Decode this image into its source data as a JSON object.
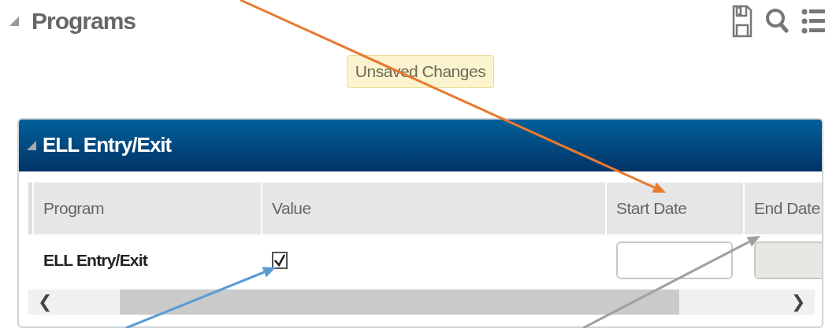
{
  "page": {
    "title": "Programs",
    "expanded": true
  },
  "toolbar": [
    {
      "kind": "save"
    },
    {
      "kind": "search"
    },
    {
      "kind": "list"
    }
  ],
  "status_badge": "Unsaved Changes",
  "panel": {
    "title": "ELL Entry/Exit",
    "expanded": true,
    "table": {
      "columns": [
        "Program",
        "Value",
        "Start Date",
        "End Date"
      ],
      "rows": [
        {
          "program": "ELL Entry/Exit",
          "checked": true,
          "start_date": {
            "disabled": false
          },
          "end_date": {
            "disabled": true
          }
        }
      ]
    },
    "scrollbar": {
      "left": "❮",
      "right": "❯"
    }
  },
  "annotations": [
    {
      "color": "#e87a2f"
    },
    {
      "color": "#5b9bd5"
    },
    {
      "color": "#a0a0a0"
    }
  ]
}
